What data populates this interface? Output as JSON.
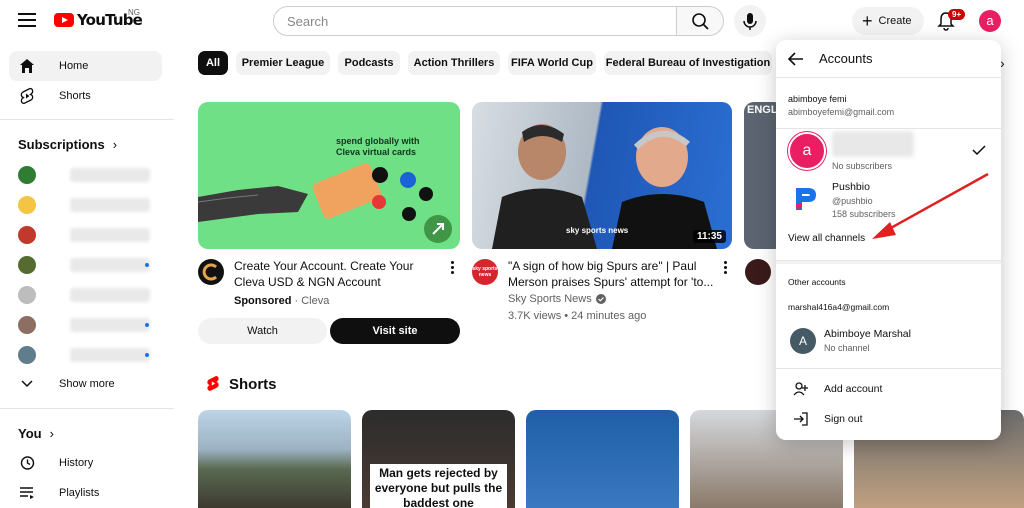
{
  "header": {
    "logo_text": "YouTube",
    "country": "NG",
    "search_placeholder": "Search",
    "create_label": "Create",
    "notifications_badge": "9+",
    "avatar_letter": "a"
  },
  "sidebar": {
    "home": "Home",
    "shorts": "Shorts",
    "subscriptions_heading": "Subscriptions",
    "show_more": "Show more",
    "you_heading": "You",
    "history": "History",
    "playlists": "Playlists"
  },
  "chips": [
    "All",
    "Premier League",
    "Podcasts",
    "Action Thrillers",
    "FIFA World Cup",
    "Federal Bureau of Investigation"
  ],
  "videos": [
    {
      "thumb_line1": "spend globally with",
      "thumb_line2": "Cleva virtual cards",
      "title_line1": "Create Your Account. Create Your",
      "title_line2": "Cleva USD & NGN Account",
      "sponsored": "Sponsored",
      "channel": "Cleva",
      "watch_label": "Watch",
      "visit_label": "Visit site"
    },
    {
      "thumb_brand": "sky sports news",
      "duration": "11:35",
      "title_line1": "\"A sign of how big Spurs are\" | Paul",
      "title_line2": "Merson praises Spurs' attempt for 'to...",
      "channel": "Sky Sports News",
      "views": "3.7K views",
      "age": "24 minutes ago",
      "avatar_text": "sky sports news"
    }
  ],
  "third_thumb_text": "ENGL",
  "shorts": {
    "heading": "Shorts",
    "caption2": "Man gets rejected by everyone but pulls the baddest one"
  },
  "accounts_panel": {
    "title": "Accounts",
    "primary_name": "abimboye femi",
    "primary_email": "abimboyefemi@gmail.com",
    "selected_avatar": "a",
    "selected_subs": "No subscribers",
    "channel2_name": "Pushbio",
    "channel2_handle": "@pushbio",
    "channel2_subs": "158 subscribers",
    "view_all": "View all channels",
    "other_heading": "Other accounts",
    "other_email": "marshal416a4@gmail.com",
    "other_avatar": "A",
    "other_name": "Abimboye Marshal",
    "other_status": "No channel",
    "add_account": "Add account",
    "sign_out": "Sign out"
  },
  "colors": {
    "brand_red": "#ff0000",
    "avatar_pink": "#e91e63",
    "cleva_green": "#6fe085",
    "annotation_arrow": "#e02020"
  }
}
